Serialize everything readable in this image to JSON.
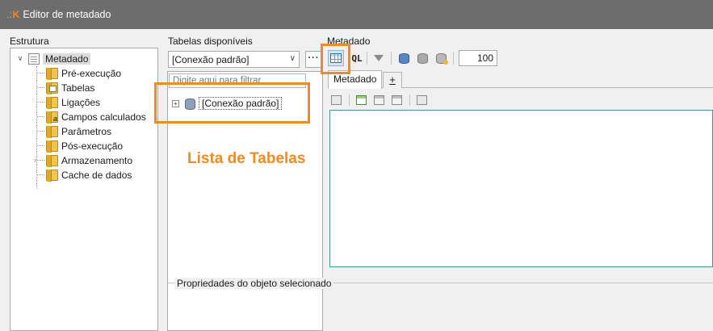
{
  "window": {
    "title": "Editor de metadado",
    "logo_letter": "K"
  },
  "structure": {
    "label": "Estrutura",
    "root": "Metadado",
    "items": [
      {
        "label": "Pré-execução",
        "icon": "folder-icon"
      },
      {
        "label": "Tabelas",
        "icon": "folder-table-icon"
      },
      {
        "label": "Ligações",
        "icon": "folder-icon"
      },
      {
        "label": "Campos calculados",
        "icon": "folder-calc-icon"
      },
      {
        "label": "Parâmetros",
        "icon": "folder-icon"
      },
      {
        "label": "Pós-execução",
        "icon": "folder-icon"
      },
      {
        "label": "Armazenamento",
        "icon": "folder-icon"
      },
      {
        "label": "Cache de dados",
        "icon": "folder-icon"
      }
    ]
  },
  "tables": {
    "label": "Tabelas disponíveis",
    "connection_selected": "[Conexão padrão]",
    "more_button": "···",
    "filter_placeholder": "Digite aqui para filtrar",
    "tree_items": [
      {
        "label": "[Conexão padrão]"
      }
    ]
  },
  "metadata": {
    "label": "Metadado",
    "sql_label": "QL",
    "limit_value": "100",
    "tabs": [
      {
        "label": "Metadado"
      },
      {
        "label": "+"
      }
    ]
  },
  "properties": {
    "title": "Propriedades do objeto selecionado"
  },
  "annotation": {
    "text": "Lista de Tabelas",
    "color": "#f28a1e"
  }
}
